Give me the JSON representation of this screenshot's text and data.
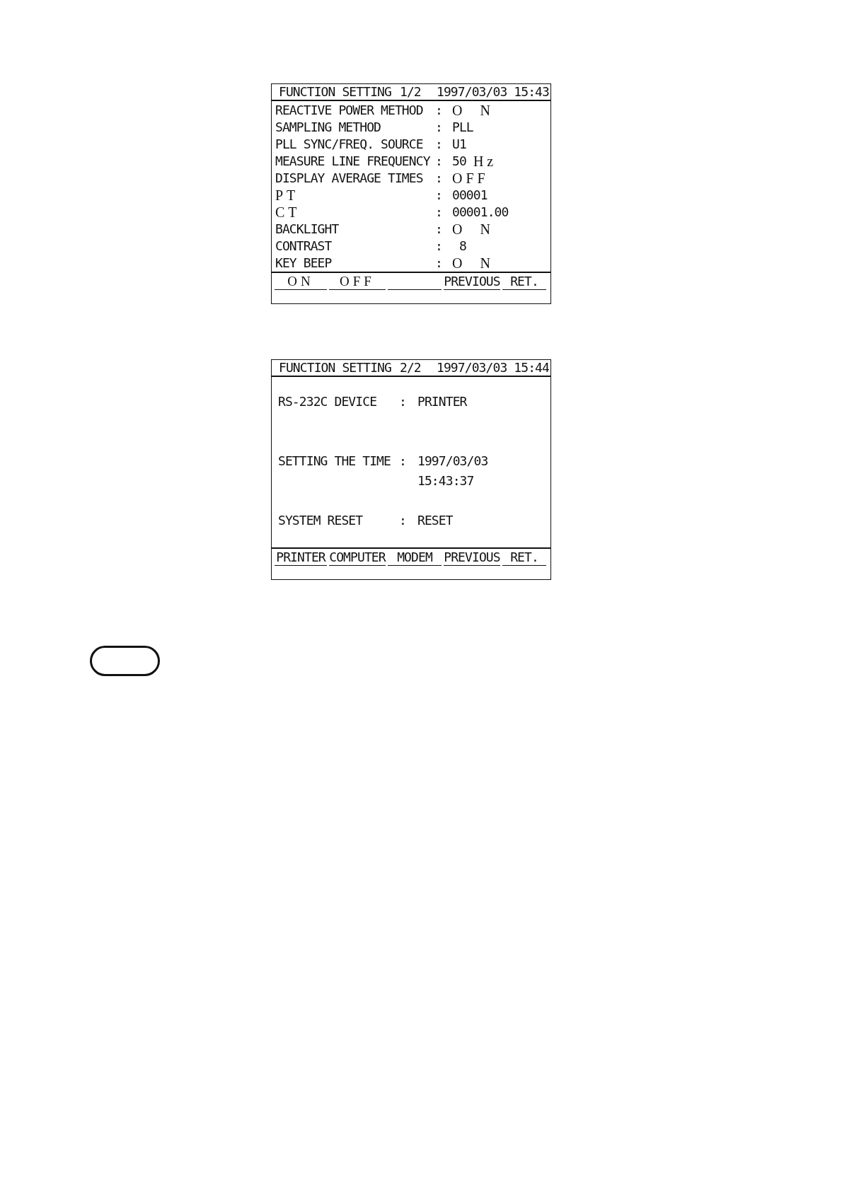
{
  "screens": [
    {
      "kind": "list",
      "title": "FUNCTION SETTING",
      "page": "1/2",
      "datetime": "1997/03/03 15:43",
      "rows": [
        {
          "kind": "switch",
          "label": "REACTIVE POWER METHOD",
          "values": [
            "O N"
          ]
        },
        {
          "kind": "plain",
          "label": "SAMPLING METHOD",
          "values": [
            "PLL"
          ]
        },
        {
          "kind": "plain",
          "label": "PLL SYNC/FREQ. SOURCE",
          "values": [
            "U1"
          ]
        },
        {
          "kind": "plain",
          "label": "MEASURE LINE FREQUENCY",
          "values": [
            "50"
          ],
          "unit": "Hz"
        },
        {
          "kind": "switch",
          "label": "DISPLAY AVERAGE TIMES",
          "values": [
            "OFF"
          ]
        },
        {
          "kind": "ratio",
          "label": "PT",
          "values": [
            "00001"
          ]
        },
        {
          "kind": "ratio",
          "label": "CT",
          "values": [
            "00001.00"
          ]
        },
        {
          "kind": "switch",
          "label": "BACKLIGHT",
          "values": [
            "O N"
          ]
        },
        {
          "kind": "plain",
          "label": "CONTRAST",
          "values": [
            " 8"
          ]
        },
        {
          "kind": "switch",
          "label": "KEY BEEP",
          "values": [
            "O N"
          ]
        }
      ],
      "softkeys": [
        {
          "kind": "switch",
          "label": "ON"
        },
        {
          "kind": "switch",
          "label": "OFF"
        },
        {
          "kind": "blank"
        },
        {
          "kind": "key",
          "label": "PREVIOUS"
        },
        {
          "kind": "key",
          "label": "RET."
        }
      ]
    },
    {
      "kind": "form",
      "title": "FUNCTION SETTING",
      "page": "2/2",
      "datetime": "1997/03/03 15:44",
      "rows": [
        {
          "kind": "plain",
          "label": "RS-232C DEVICE",
          "values": [
            "PRINTER"
          ]
        },
        {
          "kind": "plain",
          "label": "SETTING THE TIME",
          "values": [
            "1997/03/03",
            "15:43:37"
          ]
        },
        {
          "kind": "plain",
          "label": "SYSTEM RESET",
          "values": [
            "RESET"
          ]
        }
      ],
      "softkeys": [
        {
          "kind": "key",
          "label": "PRINTER"
        },
        {
          "kind": "key",
          "label": "COMPUTER"
        },
        {
          "kind": "key",
          "label": "MODEM"
        },
        {
          "kind": "key",
          "label": "PREVIOUS"
        },
        {
          "kind": "key",
          "label": "RET."
        }
      ]
    }
  ],
  "separator": ":"
}
